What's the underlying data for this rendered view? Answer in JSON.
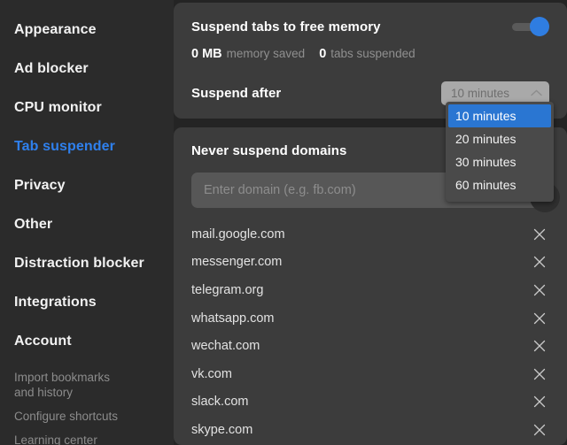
{
  "sidebar": {
    "items": [
      {
        "label": "Appearance",
        "active": false
      },
      {
        "label": "Ad blocker",
        "active": false
      },
      {
        "label": "CPU monitor",
        "active": false
      },
      {
        "label": "Tab suspender",
        "active": true
      },
      {
        "label": "Privacy",
        "active": false
      },
      {
        "label": "Other",
        "active": false
      },
      {
        "label": "Distraction blocker",
        "active": false
      },
      {
        "label": "Integrations",
        "active": false
      },
      {
        "label": "Account",
        "active": false
      }
    ],
    "secondary": [
      {
        "label": "Import bookmarks\nand history"
      },
      {
        "label": "Configure shortcuts"
      },
      {
        "label": "Learning center"
      }
    ]
  },
  "suspend_panel": {
    "title": "Suspend tabs to free memory",
    "toggle_state": "on",
    "stats": {
      "memory_value": "0 MB",
      "memory_label": "memory saved",
      "tabs_value": "0",
      "tabs_label": "tabs suspended"
    },
    "suspend_after_label": "Suspend after",
    "select": {
      "value": "10 minutes",
      "chevron": "chevron-up-icon",
      "options": [
        {
          "label": "10 minutes",
          "selected": true
        },
        {
          "label": "20 minutes",
          "selected": false
        },
        {
          "label": "30 minutes",
          "selected": false
        },
        {
          "label": "60 minutes",
          "selected": false
        }
      ]
    }
  },
  "domains_panel": {
    "title": "Never suspend domains",
    "input": {
      "value": "",
      "placeholder": "Enter domain (e.g. fb.com)"
    },
    "add_button_icon": "plus-icon",
    "items": [
      {
        "domain": "mail.google.com"
      },
      {
        "domain": "messenger.com"
      },
      {
        "domain": "telegram.org"
      },
      {
        "domain": "whatsapp.com"
      },
      {
        "domain": "wechat.com"
      },
      {
        "domain": "vk.com"
      },
      {
        "domain": "slack.com"
      },
      {
        "domain": "skype.com"
      }
    ],
    "remove_icon": "close-icon"
  },
  "colors": {
    "accent": "#2f80ed",
    "toggle_on": "#2f7de1",
    "highlight": "#2a76d2",
    "panel": "#3c3c3c",
    "sidebar": "#2b2b2b"
  }
}
